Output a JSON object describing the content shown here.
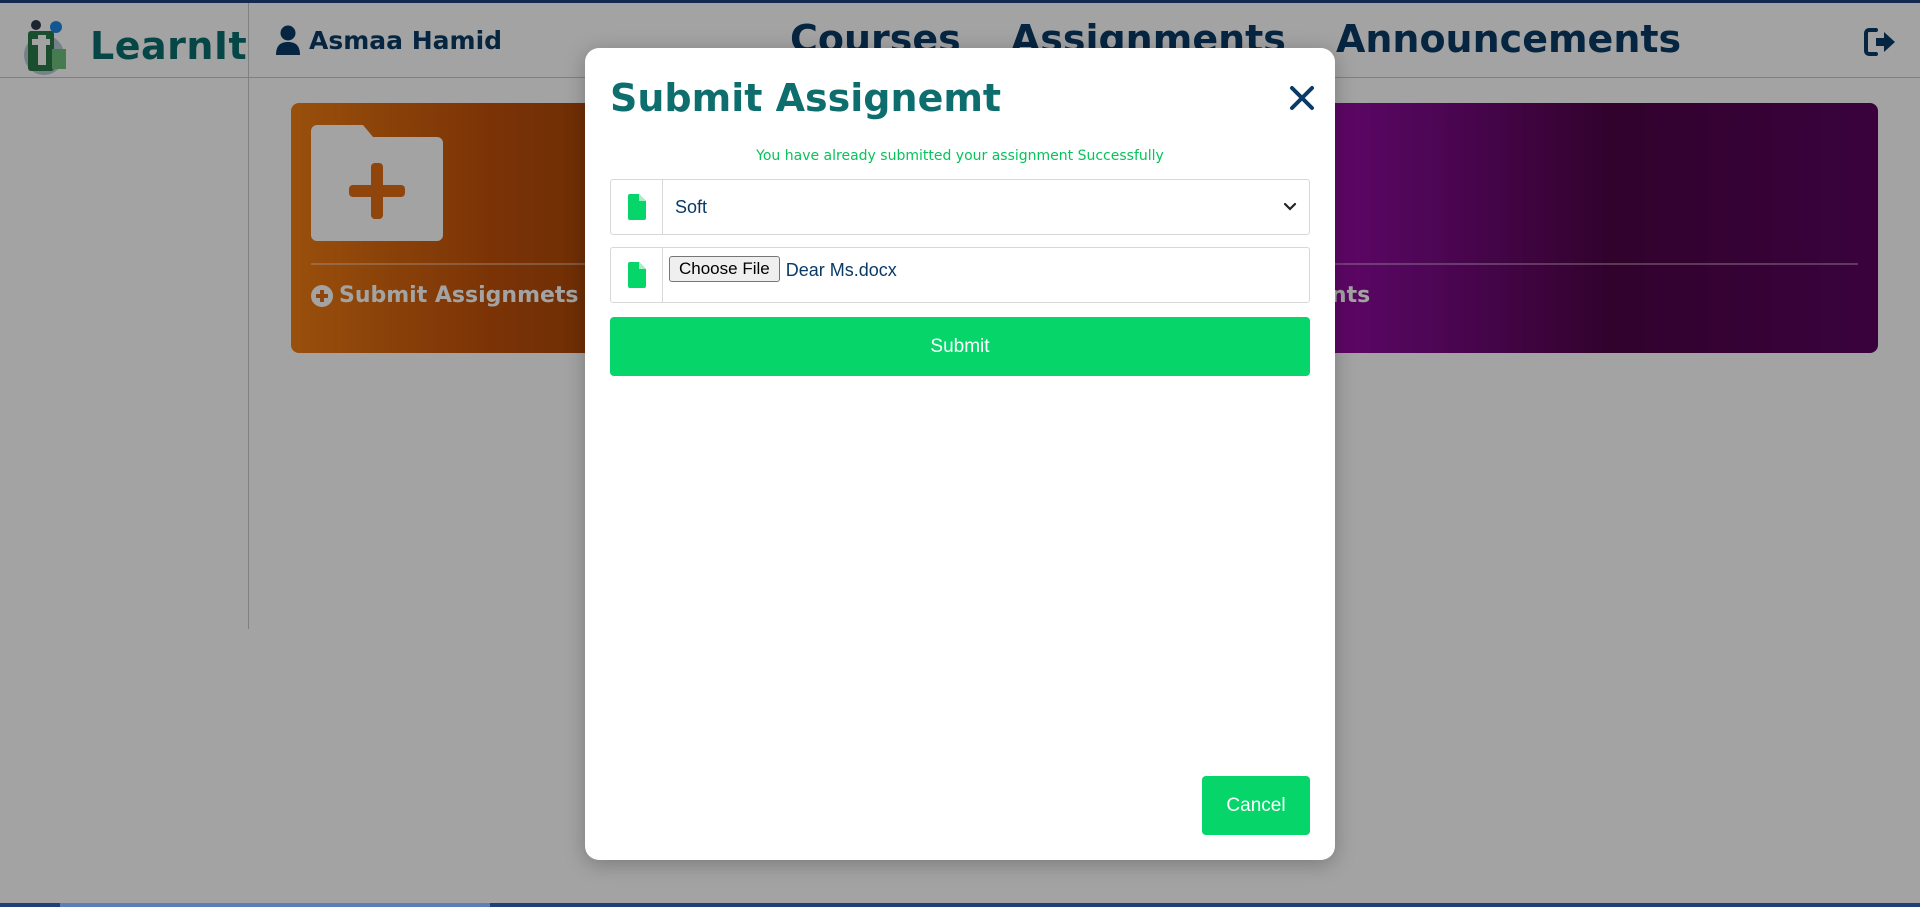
{
  "app": {
    "name": "LearnIt"
  },
  "user": {
    "name": "Asmaa Hamid"
  },
  "nav": {
    "courses": "Courses",
    "assignments": "Assignments",
    "announcements": "Announcements"
  },
  "cards": [
    {
      "label": "Submit Assignmets",
      "color": "#f07d13"
    },
    {
      "label": "ents",
      "color": "#7a0a86"
    }
  ],
  "modal": {
    "title": "Submit Assignemt",
    "success_message": "You have already submitted your assignment Successfully",
    "assignment_select": {
      "selected": "Soft"
    },
    "file_input": {
      "button_label": "Choose File",
      "file_name": "Dear Ms.docx"
    },
    "submit_label": "Submit",
    "cancel_label": "Cancel"
  },
  "colors": {
    "accent_green": "#06d66a",
    "title_teal": "#0e6e6e",
    "navy": "#0a3a66"
  },
  "icons": [
    "user-icon",
    "logout-icon",
    "folder-plus-icon",
    "plus-circle-icon",
    "close-icon",
    "file-icon",
    "chevron-down-icon"
  ]
}
